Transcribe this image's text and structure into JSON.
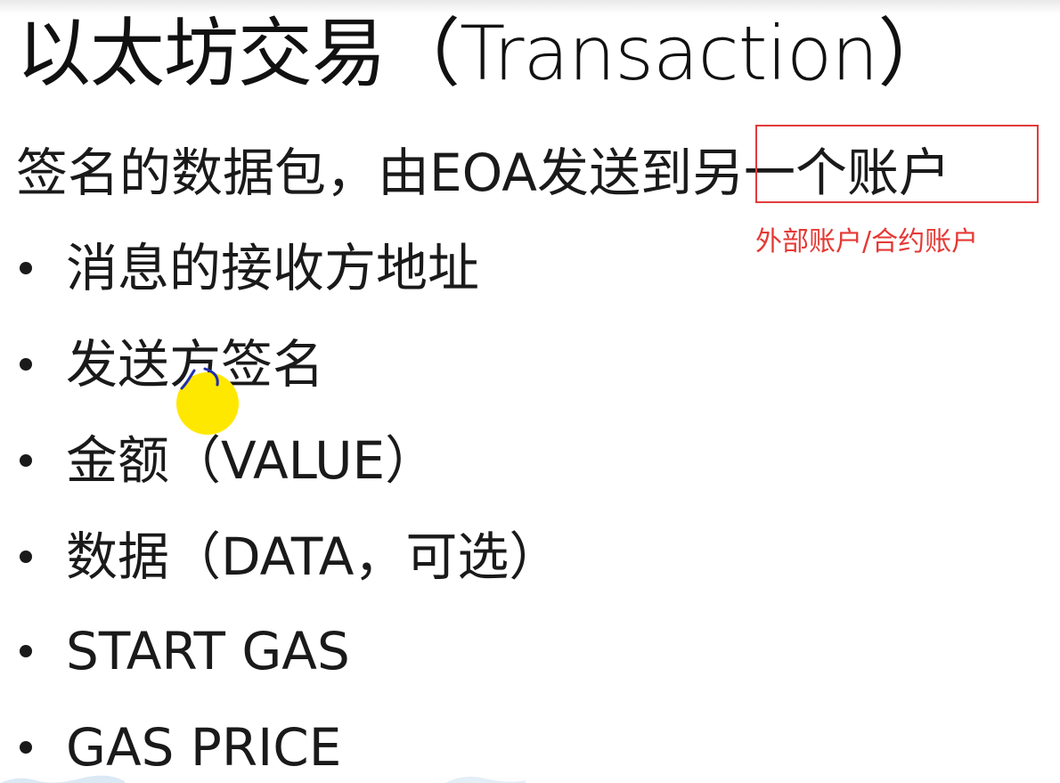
{
  "slide": {
    "title": "以太坊交易（Transaction）",
    "subtitle": "签名的数据包，由EOA发送到另一个账户",
    "highlight_note": "外部账户/合约账户",
    "highlight_color": "#e23b3b",
    "bullets": [
      "消息的接收方地址",
      "发送方签名",
      "金额（VALUE）",
      "数据（DATA，可选）",
      "START GAS",
      "GAS PRICE"
    ]
  }
}
